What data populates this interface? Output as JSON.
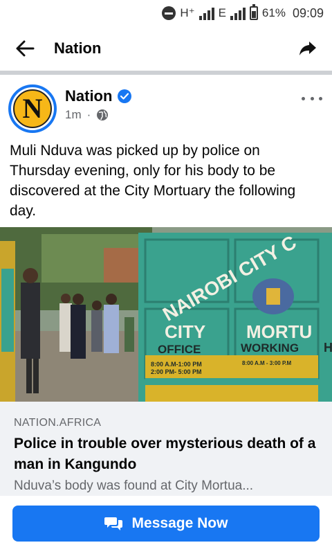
{
  "status_bar": {
    "network_label": "H⁺",
    "network2_label": "E",
    "battery_percent": "61%",
    "battery_level": 0.61,
    "time": "09:09"
  },
  "header": {
    "title": "Nation",
    "back_icon": "arrow-left-icon",
    "share_icon": "share-arrow-icon"
  },
  "post": {
    "page_name": "Nation",
    "avatar_letter": "N",
    "timestamp": "1m",
    "separator": "·",
    "text": "Muli Nduva was picked up by police on Thursday evening, only for his body to be discovered at the City Mortuary the following day.",
    "image": {
      "sign_line1": "NAIROBI CITY C",
      "sign_city": "CITY",
      "sign_mortuary": "MORTU",
      "sign_office": "OFFICE",
      "sign_working": "WORKING",
      "sign_h": "H",
      "hours_left_1": "8:00 A.M-1:00 PM",
      "hours_left_2": "2:00 PM- 5:00 PM",
      "hours_right": "8:00 A.M - 3:00 P.M"
    }
  },
  "link_preview": {
    "domain": "NATION.AFRICA",
    "title": "Police in trouble over mysterious death of a man in Kangundo",
    "description": "Nduva’s body was found at City Mortua..."
  },
  "cta": {
    "label": "Message Now"
  },
  "colors": {
    "brand_blue": "#1877f2",
    "avatar_yellow": "#f7b718",
    "gate_teal": "#3aa28e",
    "gate_yellow": "#d9b32a"
  }
}
